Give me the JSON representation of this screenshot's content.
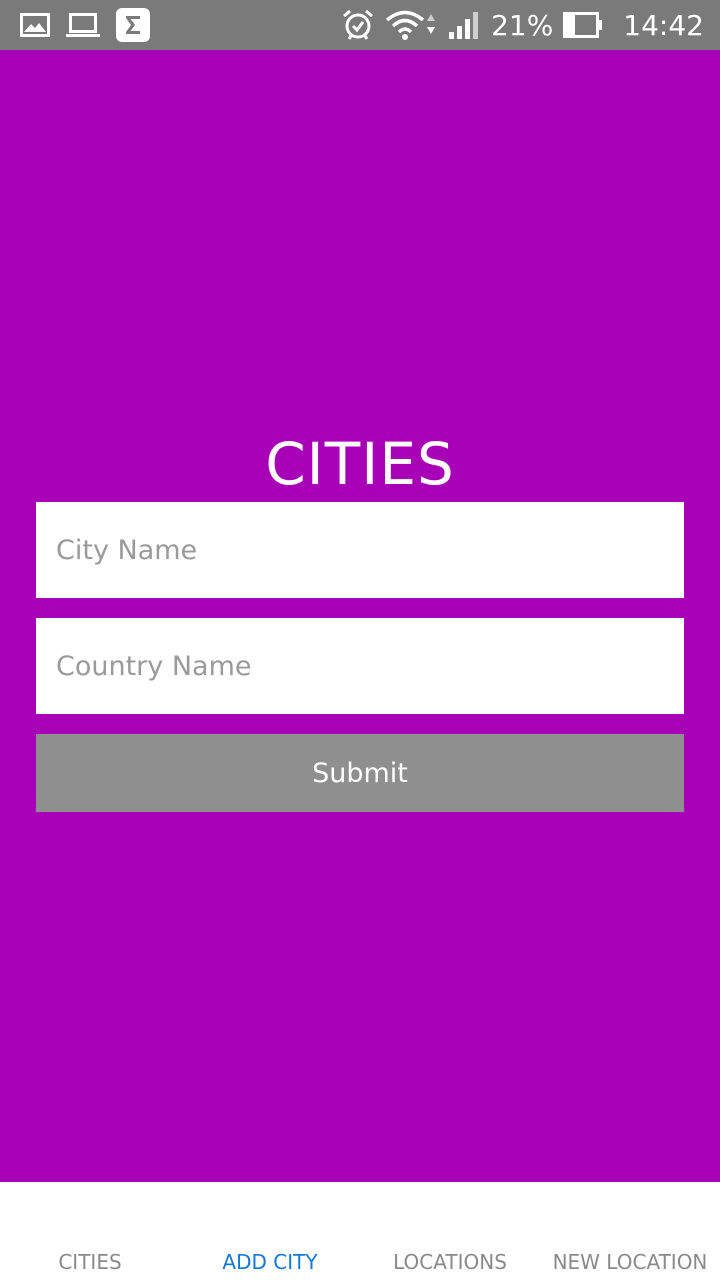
{
  "status_bar": {
    "icons_left": [
      "gallery-icon",
      "laptop-icon",
      "sigma-app-icon"
    ],
    "icons_right": [
      "alarm-icon",
      "wifi-icon",
      "signal-icon",
      "battery-icon"
    ],
    "battery_percent": "21%",
    "battery_level": 0.21,
    "time": "14:42",
    "background_color": "#7a7a7a"
  },
  "screen": {
    "background_color": "#a800b7",
    "title": "CITIES",
    "city_field": {
      "value": "",
      "placeholder": "City Name"
    },
    "country_field": {
      "value": "",
      "placeholder": "Country Name"
    },
    "submit_label": "Submit",
    "submit_color": "#8f8f8f"
  },
  "tabs": [
    {
      "label": "CITIES",
      "active": false
    },
    {
      "label": "ADD CITY",
      "active": true
    },
    {
      "label": "LOCATIONS",
      "active": false
    },
    {
      "label": "NEW LOCATION",
      "active": false
    }
  ],
  "active_tab_color": "#1577d6"
}
